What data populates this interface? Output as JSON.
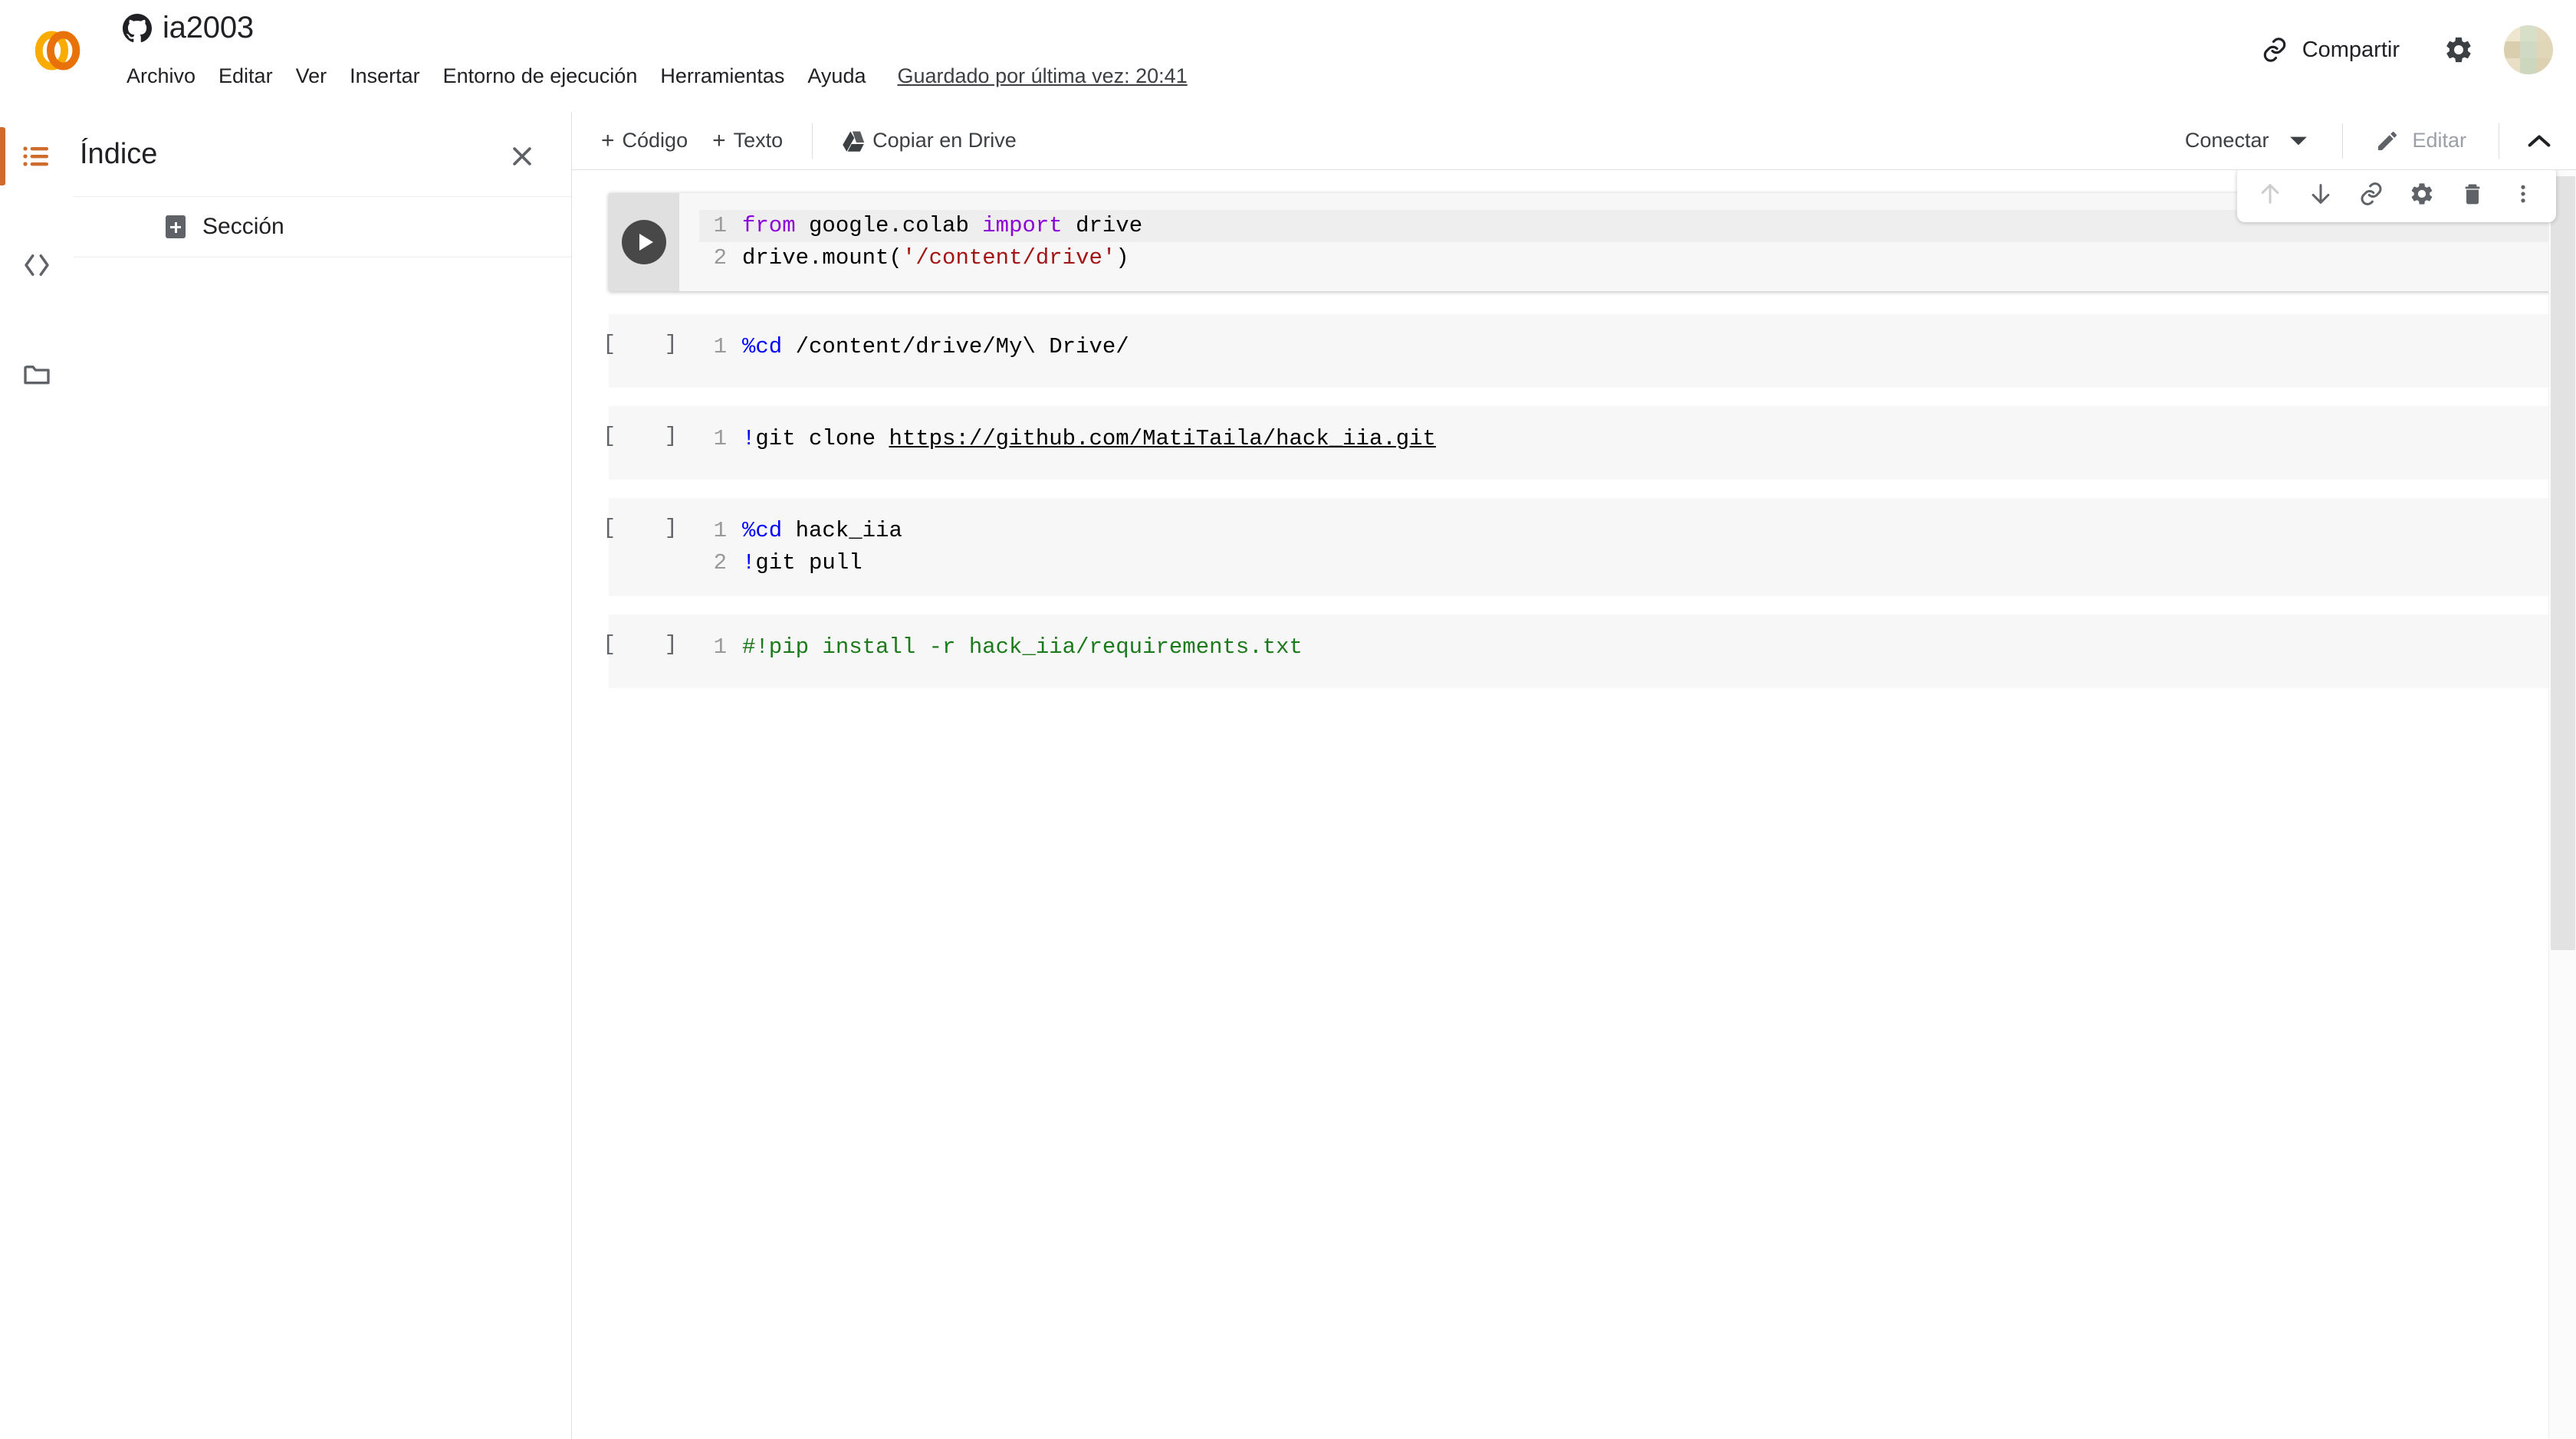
{
  "header": {
    "logo_alt": "colab-logo",
    "github_icon": "github-icon",
    "notebook_title": "ia2003",
    "menu": [
      {
        "label": "Archivo"
      },
      {
        "label": "Editar"
      },
      {
        "label": "Ver"
      },
      {
        "label": "Insertar"
      },
      {
        "label": "Entorno de ejecución"
      },
      {
        "label": "Herramientas"
      },
      {
        "label": "Ayuda"
      }
    ],
    "saved_status": "Guardado por última vez: 20:41",
    "share_label": "Compartir",
    "settings_icon": "gear-icon",
    "avatar_alt": "user-avatar"
  },
  "toolbar": {
    "add_code_label": "Código",
    "add_text_label": "Texto",
    "copy_drive_label": "Copiar en Drive",
    "connect_label": "Conectar",
    "edit_label": "Editar",
    "plus_glyph": "+"
  },
  "rail": {
    "items": [
      {
        "name": "toc-icon",
        "active": true
      },
      {
        "name": "code-snippets-icon",
        "active": false
      },
      {
        "name": "files-icon",
        "active": false
      }
    ],
    "accent_color": "#cf6b2d"
  },
  "sidebar": {
    "title": "Índice",
    "close_icon": "close-icon",
    "entries": [
      {
        "label": "Sección",
        "expand_icon": "expand-plus-icon"
      }
    ]
  },
  "cell_toolbar": {
    "buttons": [
      {
        "name": "move-cell-up-icon",
        "label": "Mover celda hacia arriba",
        "disabled": true
      },
      {
        "name": "move-cell-down-icon",
        "label": "Mover celda hacia abajo",
        "disabled": false
      },
      {
        "name": "link-to-cell-icon",
        "label": "Vincular a la celda",
        "disabled": false
      },
      {
        "name": "cell-settings-gear-icon",
        "label": "Configuración de celda",
        "disabled": false
      },
      {
        "name": "delete-cell-trash-icon",
        "label": "Borrar celda",
        "disabled": false
      },
      {
        "name": "more-options-kebab-icon",
        "label": "Más opciones",
        "disabled": false
      }
    ]
  },
  "notebook": {
    "prompt_empty": "[ ]",
    "cells": [
      {
        "id": "cell-1",
        "active": true,
        "prompt": "",
        "lines": [
          {
            "n": "1",
            "highlight": true,
            "tokens": [
              {
                "t": "from ",
                "c": "kw"
              },
              {
                "t": "google.colab ",
                "c": ""
              },
              {
                "t": "import ",
                "c": "kw"
              },
              {
                "t": "drive",
                "c": ""
              }
            ]
          },
          {
            "n": "2",
            "highlight": false,
            "tokens": [
              {
                "t": "drive.mount(",
                "c": ""
              },
              {
                "t": "'/content/drive'",
                "c": "str"
              },
              {
                "t": ")",
                "c": ""
              }
            ]
          }
        ]
      },
      {
        "id": "cell-2",
        "active": false,
        "prompt": "[  ]",
        "lines": [
          {
            "n": "1",
            "highlight": false,
            "tokens": [
              {
                "t": "%cd",
                "c": "mag"
              },
              {
                "t": " /content/drive/My\\ Drive/",
                "c": ""
              }
            ]
          }
        ]
      },
      {
        "id": "cell-3",
        "active": false,
        "prompt": "[  ]",
        "lines": [
          {
            "n": "1",
            "highlight": false,
            "tokens": [
              {
                "t": "!",
                "c": "bang"
              },
              {
                "t": "git clone ",
                "c": ""
              },
              {
                "t": "https://github.com/MatiTaila/hack_iia.git",
                "c": "lnk"
              }
            ]
          }
        ]
      },
      {
        "id": "cell-4",
        "active": false,
        "prompt": "[  ]",
        "lines": [
          {
            "n": "1",
            "highlight": false,
            "tokens": [
              {
                "t": "%cd",
                "c": "mag"
              },
              {
                "t": " hack_iia",
                "c": ""
              }
            ]
          },
          {
            "n": "2",
            "highlight": false,
            "tokens": [
              {
                "t": "!",
                "c": "bang"
              },
              {
                "t": "git pull",
                "c": ""
              }
            ]
          }
        ]
      },
      {
        "id": "cell-5",
        "active": false,
        "prompt": "[  ]",
        "lines": [
          {
            "n": "1",
            "highlight": false,
            "tokens": [
              {
                "t": "#!pip install -r hack_iia/requirements.txt",
                "c": "cmt"
              }
            ]
          }
        ]
      }
    ]
  },
  "colors": {
    "accent_orange": "#cf6b2d",
    "logo_orange_light": "#f9ab00",
    "logo_orange_dark": "#e8710a",
    "cell_bg": "#f7f7f7",
    "keyword_purple": "#8b00d8",
    "string_red": "#a31515",
    "magic_blue": "#0000ff",
    "comment_green": "#1b7a1b"
  }
}
